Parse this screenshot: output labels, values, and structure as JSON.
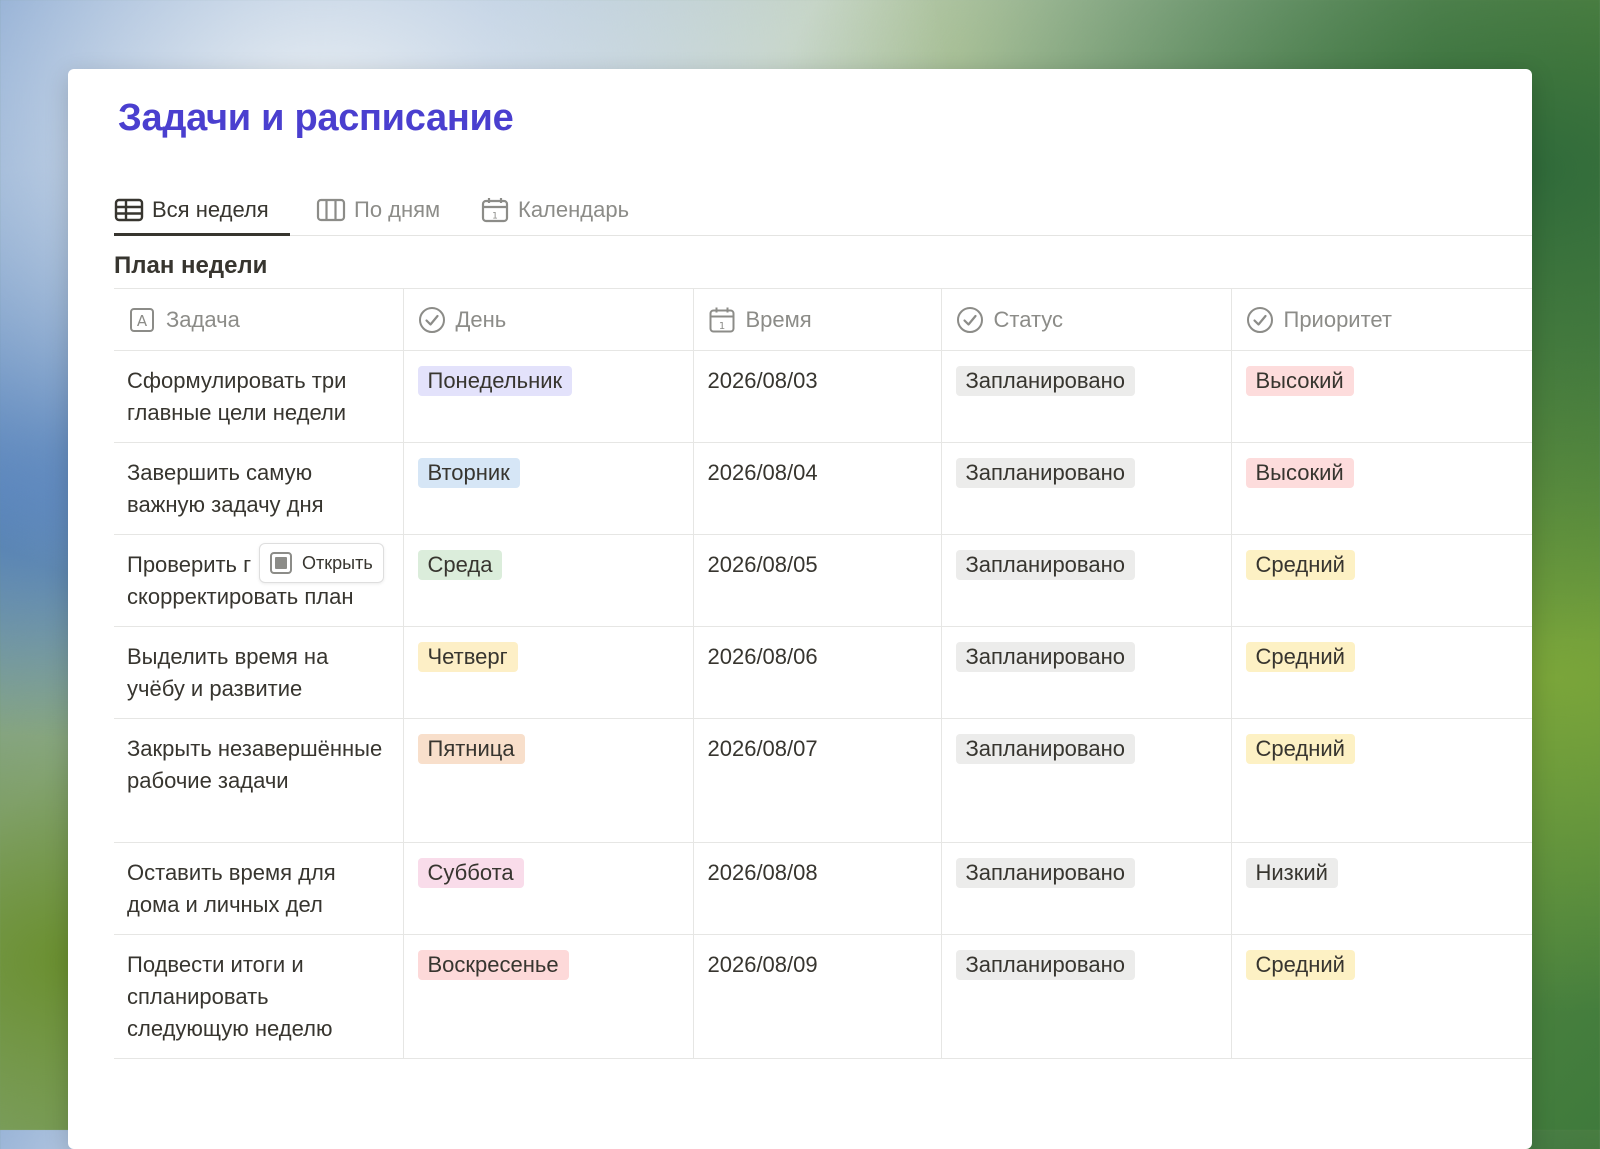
{
  "page": {
    "title": "Задачи и расписание"
  },
  "tabs": [
    {
      "label": "Вся неделя",
      "icon": "table-icon",
      "active": true
    },
    {
      "label": "По дням",
      "icon": "board-icon",
      "active": false
    },
    {
      "label": "Календарь",
      "icon": "calendar-icon",
      "active": false
    }
  ],
  "section": {
    "title": "План недели"
  },
  "columns": [
    {
      "label": "Задача",
      "icon": "text-icon"
    },
    {
      "label": "День",
      "icon": "select-icon"
    },
    {
      "label": "Время",
      "icon": "date-icon"
    },
    {
      "label": "Статус",
      "icon": "select-icon"
    },
    {
      "label": "Приоритет",
      "icon": "select-icon"
    }
  ],
  "open_button": {
    "label": "Открыть",
    "icon": "page-icon"
  },
  "rows": [
    {
      "task": "Сформулировать три главные цели недели",
      "day": "Понедельник",
      "day_color": "#e3e2fb",
      "date": "2026/08/03",
      "status": "Запланировано",
      "priority": "Высокий",
      "priority_color": "#fddcdc"
    },
    {
      "task": "Завершить самую важную задачу дня",
      "day": "Вторник",
      "day_color": "#d6e6f6",
      "date": "2026/08/04",
      "status": "Запланировано",
      "priority": "Высокий",
      "priority_color": "#fddcdc"
    },
    {
      "task": "Проверить г",
      "task_line2": "скорректировать план",
      "day": "Среда",
      "day_color": "#dbeddb",
      "date": "2026/08/05",
      "status": "Запланировано",
      "priority": "Средний",
      "priority_color": "#fdf1c4"
    },
    {
      "task": "Выделить время на учёбу и развитие",
      "day": "Четверг",
      "day_color": "#fdefc6",
      "date": "2026/08/06",
      "status": "Запланировано",
      "priority": "Средний",
      "priority_color": "#fdf1c4"
    },
    {
      "task": "Закрыть незавершённые рабочие задачи",
      "day": "Пятница",
      "day_color": "#f8dfcb",
      "date": "2026/08/07",
      "status": "Запланировано",
      "priority": "Средний",
      "priority_color": "#fdf1c4"
    },
    {
      "task": "Оставить время для дома и личных дел",
      "day": "Суббота",
      "day_color": "#f9dcea",
      "date": "2026/08/08",
      "status": "Запланировано",
      "priority": "Низкий",
      "priority_color": "#ececeb"
    },
    {
      "task": "Подвести итоги и спланировать следующую неделю",
      "day": "Воскресенье",
      "day_color": "#fdd9d9",
      "date": "2026/08/09",
      "status": "Запланировано",
      "priority": "Средний",
      "priority_color": "#fdf1c4"
    }
  ],
  "colors": {
    "title": "#4a3fcf",
    "status_pill": "#ececeb",
    "text": "#37352f",
    "muted": "#8c8c88"
  }
}
